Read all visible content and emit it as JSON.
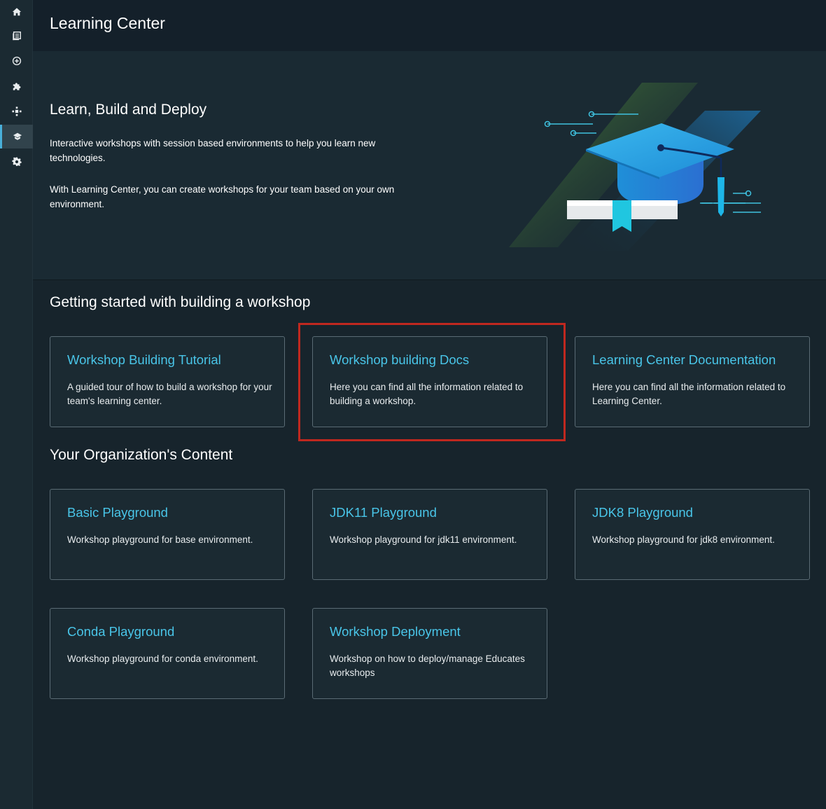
{
  "sidebar": {
    "items": [
      {
        "icon": "home-icon"
      },
      {
        "icon": "catalog-icon"
      },
      {
        "icon": "create-icon"
      },
      {
        "icon": "plugin-icon"
      },
      {
        "icon": "network-icon"
      },
      {
        "icon": "learning-center-icon",
        "active": true
      },
      {
        "icon": "settings-icon"
      }
    ]
  },
  "header": {
    "title": "Learning Center"
  },
  "hero": {
    "title": "Learn, Build and Deploy",
    "paragraph1": "Interactive workshops with session based environments to help you learn new technologies.",
    "paragraph2": "With Learning Center, you can create workshops for your team based on your own environment."
  },
  "getting_started": {
    "title": "Getting started with building a workshop",
    "cards": [
      {
        "title": "Workshop Building Tutorial",
        "description": "A guided tour of how to build a workshop for your team's learning center."
      },
      {
        "title": "Workshop building Docs",
        "description": "Here you can find all the information related to building a workshop."
      },
      {
        "title": "Learning Center Documentation",
        "description": "Here you can find all the information related to Learning Center."
      }
    ]
  },
  "org_content": {
    "title": "Your Organization's Content",
    "cards": [
      {
        "title": "Basic Playground",
        "description": "Workshop playground for base environment."
      },
      {
        "title": "JDK11 Playground",
        "description": "Workshop playground for jdk11 environment."
      },
      {
        "title": "JDK8 Playground",
        "description": "Workshop playground for jdk8 environment."
      },
      {
        "title": "Conda Playground",
        "description": "Workshop playground for conda environment."
      },
      {
        "title": "Workshop Deployment",
        "description": "Workshop on how to deploy/manage Educates workshops"
      }
    ]
  },
  "colors": {
    "accent": "#49c5e8",
    "highlight": "#c0281f",
    "background": "#17242c"
  }
}
